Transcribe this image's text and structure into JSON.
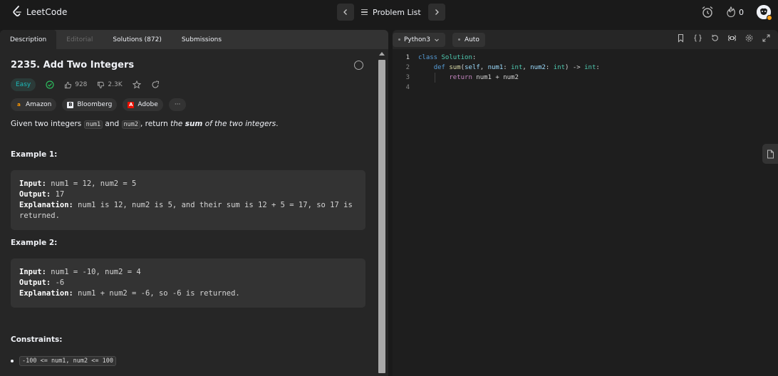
{
  "app": {
    "name": "LeetCode"
  },
  "header": {
    "problem_list_label": "Problem List",
    "prev_icon": "chevron-left-icon",
    "next_icon": "chevron-right-icon",
    "streak_count": "0"
  },
  "tabs": [
    {
      "label": "Description",
      "active": true
    },
    {
      "label": "Editorial",
      "active": false
    },
    {
      "label": "Solutions (872)",
      "active": false
    },
    {
      "label": "Submissions",
      "active": false
    }
  ],
  "problem": {
    "title": "2235. Add Two Integers",
    "difficulty": "Easy",
    "likes": "928",
    "dislikes": "2.3K",
    "companies": [
      "Amazon",
      "Bloomberg",
      "Adobe"
    ],
    "more_companies": "···",
    "description": {
      "p1": "Given two integers ",
      "c1": "num1",
      "p2": " and ",
      "c2": "num2",
      "p3": ", return ",
      "em1": "the ",
      "strong": "sum",
      "em2": " of the two integers",
      "p4": "."
    },
    "examples": [
      {
        "title": "Example 1:",
        "input_label": "Input:",
        "input": " num1 = 12, num2 = 5",
        "output_label": "Output:",
        "output": " 17",
        "explanation_label": "Explanation:",
        "explanation": " num1 is 12, num2 is 5, and their sum is 12 + 5 = 17, so 17 is",
        "explanation_cont": "returned."
      },
      {
        "title": "Example 2:",
        "input_label": "Input:",
        "input": " num1 = -10, num2 = 4",
        "output_label": "Output:",
        "output": " -6",
        "explanation_label": "Explanation:",
        "explanation": " num1 + num2 = -6, so -6 is returned."
      }
    ],
    "constraints_title": "Constraints:",
    "constraints": [
      "-100 <= num1, num2 <= 100"
    ]
  },
  "editor": {
    "language": "Python3",
    "autocomplete": "Auto",
    "line_numbers": [
      "1",
      "2",
      "3",
      "4"
    ],
    "code": {
      "l1_kw": "class",
      "l1_cls": "Solution",
      "l1_end": ":",
      "l2_kw": "def",
      "l2_fn": "sum",
      "l2_a": "(",
      "l2_self": "self",
      "l2_b": ", ",
      "l2_p1": "num1",
      "l2_c": ": ",
      "l2_t1": "int",
      "l2_d": ", ",
      "l2_p2": "num2",
      "l2_e": ": ",
      "l2_t2": "int",
      "l2_f": ") -> ",
      "l2_t3": "int",
      "l2_g": ":",
      "l3_ret": "return",
      "l3_rest": " num1 + num2"
    }
  },
  "colors": {
    "accent": "#ffa116",
    "easy": "#1cbaba",
    "background": "#1a1a1a",
    "panel": "#262626"
  }
}
